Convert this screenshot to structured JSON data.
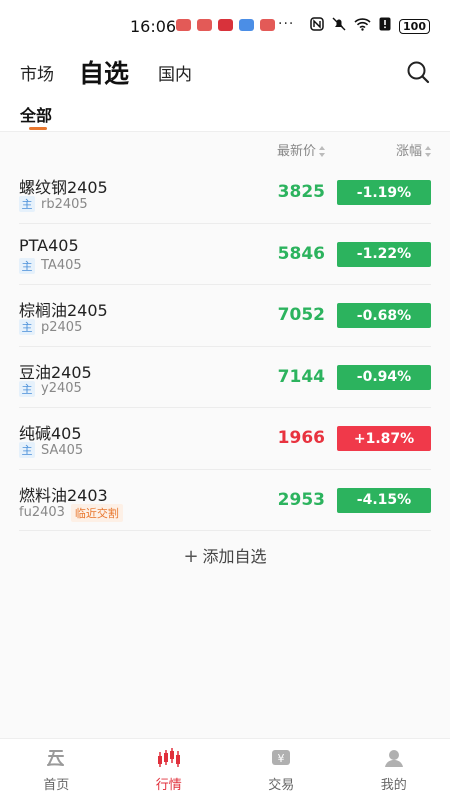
{
  "status_bar": {
    "time": "16:06",
    "more": "···",
    "battery": "100",
    "notif_colors": [
      "#e35a57",
      "#e35a57",
      "#d8323b",
      "#4b8ee6",
      "#e35a57"
    ]
  },
  "top_nav": {
    "items": [
      "市场",
      "自选",
      "国内"
    ],
    "active": "自选"
  },
  "sub_tabs": {
    "active": "全部"
  },
  "columns": {
    "price": "最新价",
    "change": "涨幅"
  },
  "rows": [
    {
      "name": "螺纹钢2405",
      "main_badge": "主",
      "code": "rb2405",
      "price": "3825",
      "change": "-1.19%",
      "dir": "down"
    },
    {
      "name": "PTA405",
      "main_badge": "主",
      "code": "TA405",
      "price": "5846",
      "change": "-1.22%",
      "dir": "down"
    },
    {
      "name": "棕榈油2405",
      "main_badge": "主",
      "code": "p2405",
      "price": "7052",
      "change": "-0.68%",
      "dir": "down"
    },
    {
      "name": "豆油2405",
      "main_badge": "主",
      "code": "y2405",
      "price": "7144",
      "change": "-0.94%",
      "dir": "down"
    },
    {
      "name": "纯碱405",
      "main_badge": "主",
      "code": "SA405",
      "price": "1966",
      "change": "+1.87%",
      "dir": "up"
    },
    {
      "name": "燃料油2403",
      "code": "fu2403",
      "warn_badge": "临近交割",
      "price": "2953",
      "change": "-4.15%",
      "dir": "down"
    }
  ],
  "add_button": {
    "label": "添加自选"
  },
  "tab_bar": {
    "items": [
      {
        "label": "首页",
        "icon": "home-icon"
      },
      {
        "label": "行情",
        "icon": "candlestick-icon",
        "active": true
      },
      {
        "label": "交易",
        "icon": "trade-icon"
      },
      {
        "label": "我的",
        "icon": "profile-icon"
      }
    ]
  },
  "colors": {
    "down": "#2cb35e",
    "up": "#f0394a",
    "accent": "#e8772e",
    "active_tab": "#e0303c"
  }
}
